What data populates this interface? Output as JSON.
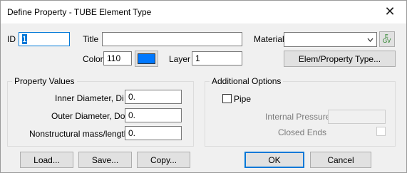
{
  "window": {
    "title": "Define Property - TUBE Element Type",
    "close_glyph": "✕"
  },
  "fields": {
    "id": {
      "label": "ID",
      "value": "1"
    },
    "title": {
      "label": "Title",
      "value": ""
    },
    "material": {
      "label": "Material",
      "value": ""
    },
    "color": {
      "label": "Color",
      "value": "110",
      "swatch": "#0078ff"
    },
    "layer": {
      "label": "Layer",
      "value": "1"
    }
  },
  "buttons": {
    "elem_property_type": "Elem/Property Type...",
    "load": "Load...",
    "save": "Save...",
    "copy": "Copy...",
    "ok": "OK",
    "cancel": "Cancel"
  },
  "property_values": {
    "title": "Property Values",
    "inner_diameter": {
      "label": "Inner Diameter, Di",
      "value": "0."
    },
    "outer_diameter": {
      "label": "Outer Diameter, Do",
      "value": "0."
    },
    "nonstructural_mass": {
      "label": "Nonstructural mass/length",
      "value": "0."
    }
  },
  "additional_options": {
    "title": "Additional Options",
    "pipe": {
      "label": "Pipe",
      "checked": false
    },
    "internal_pressure": {
      "label": "Internal Pressure",
      "value": ""
    },
    "closed_ends": {
      "label": "Closed Ends",
      "checked": false
    }
  },
  "icons": {
    "material_library": "material-library-icon",
    "dropdown": "chevron-down-icon"
  }
}
